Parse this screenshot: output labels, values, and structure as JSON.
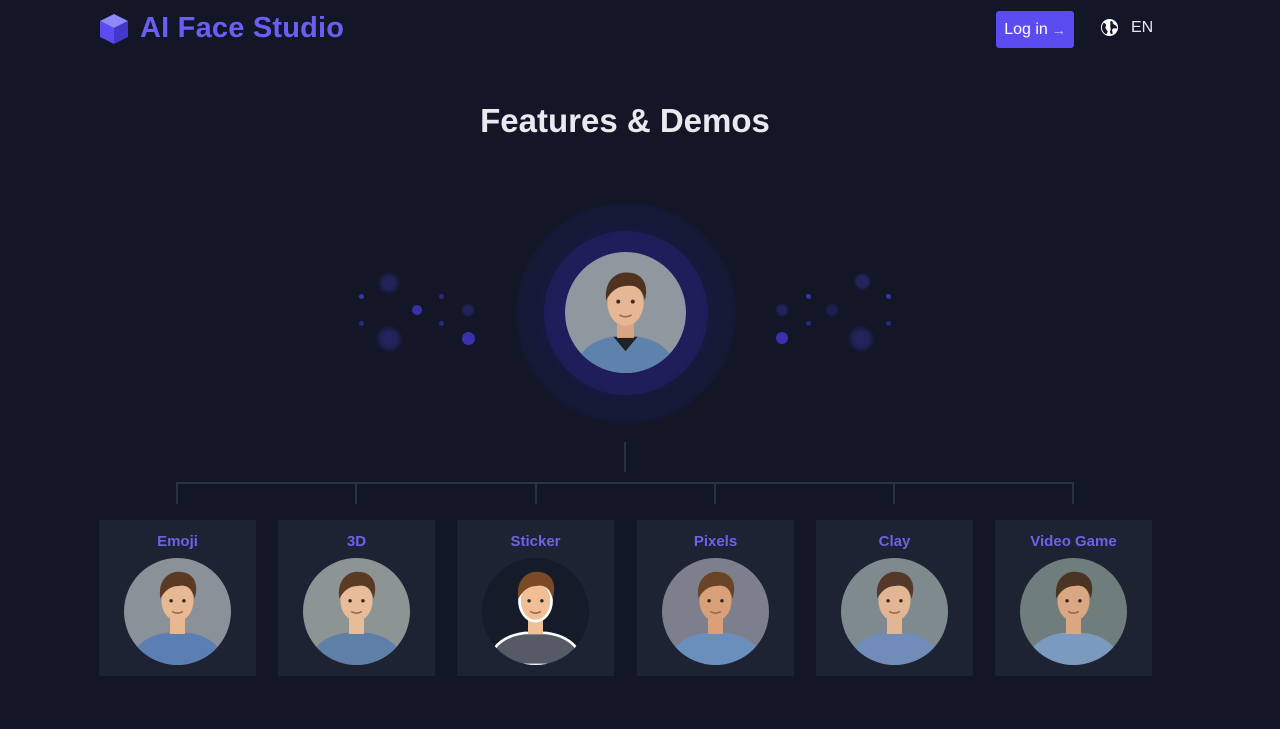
{
  "header": {
    "brand": "AI Face Studio",
    "login_label": "Log in",
    "login_arrow": "→",
    "language": "EN"
  },
  "main": {
    "title": "Features & Demos"
  },
  "features": [
    {
      "label": "Emoji",
      "bg": "#8a9199",
      "shirt": "#5b7fb2",
      "skin": "#e7b892",
      "hair": "#5a3a22"
    },
    {
      "label": "3D",
      "bg": "#8c9494",
      "shirt": "#5e7fa8",
      "skin": "#e8bc98",
      "hair": "#5a3a24"
    },
    {
      "label": "Sticker",
      "bg": "#161b2a",
      "shirt": "#555a66",
      "skin": "#f0bf96",
      "hair": "#7a4a24"
    },
    {
      "label": "Pixels",
      "bg": "#7d808c",
      "shirt": "#6b8fbd",
      "skin": "#d9a07a",
      "hair": "#6b4428"
    },
    {
      "label": "Clay",
      "bg": "#7e8a8e",
      "shirt": "#6f8db8",
      "skin": "#e3b693",
      "hair": "#54392a"
    },
    {
      "label": "Video Game",
      "bg": "#6f7e7c",
      "shirt": "#7a9bbf",
      "skin": "#d9a883",
      "hair": "#4a3424"
    }
  ],
  "colors": {
    "accent": "#5a4cf0",
    "brand_text": "#6b5df5",
    "card_bg": "#1d2333",
    "page_bg": "#121626"
  }
}
